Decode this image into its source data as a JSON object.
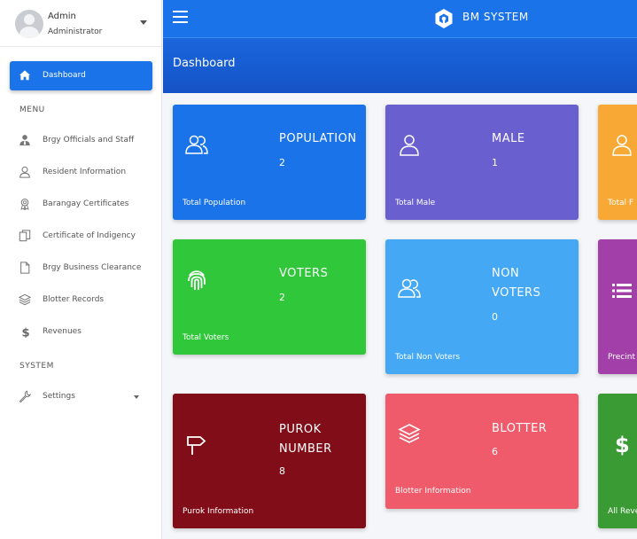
{
  "sidebar": {
    "user": {
      "name": "Admin",
      "role": "Administrator"
    },
    "active_item": "Dashboard",
    "sections": {
      "menu": "MENU",
      "system": "SYSTEM"
    },
    "items": [
      {
        "label": "Brgy Officials and Staff",
        "icon": "user-tie-icon"
      },
      {
        "label": "Resident Information",
        "icon": "user-icon"
      },
      {
        "label": "Barangay Certificates",
        "icon": "certificate-icon"
      },
      {
        "label": "Certificate of Indigency",
        "icon": "copy-icon"
      },
      {
        "label": "Brgy Business Clearance",
        "icon": "file-icon"
      },
      {
        "label": "Blotter Records",
        "icon": "layers-icon"
      },
      {
        "label": "Revenues",
        "icon": "dollar-icon"
      }
    ],
    "settings": {
      "label": "Settings",
      "icon": "wrench-icon"
    }
  },
  "topbar": {
    "brand": "BM SYSTEM"
  },
  "header": {
    "title": "Dashboard"
  },
  "colors": {
    "primary": "#1a73e8",
    "population": "#1a73e8",
    "male": "#6a5fcf",
    "female": "#f8a935",
    "voters": "#30c83a",
    "non_voters": "#44a8f5",
    "precinct": "#a33fa8",
    "purok": "#800d17",
    "blotter": "#f05b6b",
    "revenue": "#3a9b35"
  },
  "cards": {
    "population": {
      "title1": "POPULATION",
      "value": "2",
      "footer": "Total Population",
      "icon": "users-icon"
    },
    "male": {
      "title1": "MALE",
      "value": "1",
      "footer": "Total Male",
      "icon": "male-user-icon"
    },
    "female": {
      "footer": "Total F",
      "icon": "female-user-icon"
    },
    "voters": {
      "title1": "VOTERS",
      "value": "2",
      "footer": "Total Voters",
      "icon": "fingerprint-icon"
    },
    "non_voters": {
      "title1": "NON",
      "title2": "VOTERS",
      "value": "0",
      "footer": "Total Non Voters",
      "icon": "users-icon"
    },
    "precinct": {
      "footer": "Precint",
      "icon": "list-icon"
    },
    "purok": {
      "title1": "PUROK",
      "title2": "NUMBER",
      "value": "8",
      "footer": "Purok Information",
      "icon": "signpost-icon"
    },
    "blotter": {
      "title1": "BLOTTER",
      "value": "6",
      "footer": "Blotter Information",
      "icon": "layers-icon"
    },
    "revenue": {
      "footer": "All Reve",
      "icon": "dollar-icon"
    }
  }
}
